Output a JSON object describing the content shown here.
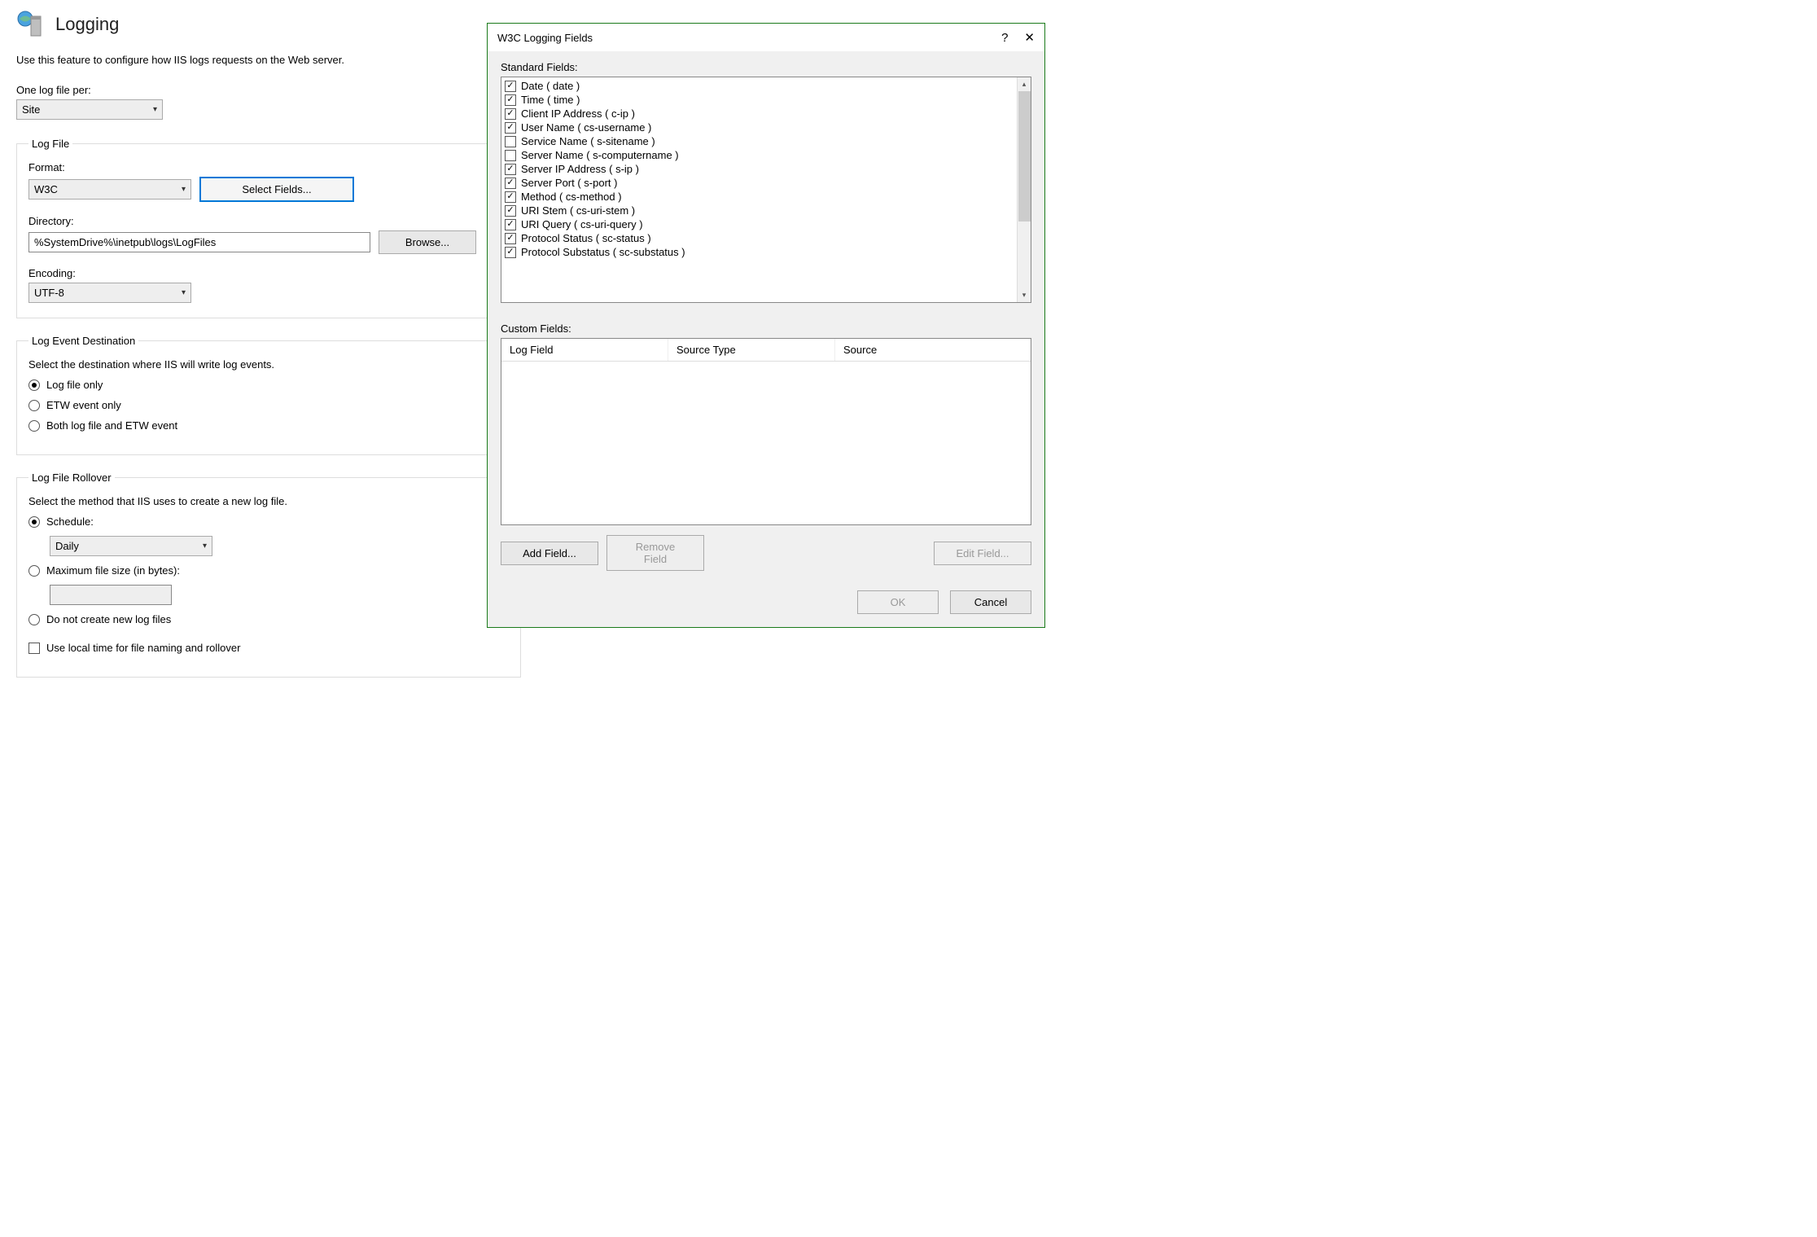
{
  "page": {
    "title": "Logging",
    "description": "Use this feature to configure how IIS logs requests on the Web server.",
    "oneLogFilePerLabel": "One log file per:",
    "oneLogFilePerValue": "Site"
  },
  "logFile": {
    "legend": "Log File",
    "formatLabel": "Format:",
    "formatValue": "W3C",
    "selectFieldsButton": "Select Fields...",
    "directoryLabel": "Directory:",
    "directoryValue": "%SystemDrive%\\inetpub\\logs\\LogFiles",
    "browseButton": "Browse...",
    "encodingLabel": "Encoding:",
    "encodingValue": "UTF-8"
  },
  "logEventDestination": {
    "legend": "Log Event Destination",
    "description": "Select the destination where IIS will write log events.",
    "options": {
      "fileOnly": "Log file only",
      "etwOnly": "ETW event only",
      "both": "Both log file and ETW event"
    }
  },
  "logFileRollover": {
    "legend": "Log File Rollover",
    "description": "Select the method that IIS uses to create a new log file.",
    "scheduleLabel": "Schedule:",
    "scheduleValue": "Daily",
    "maxSizeLabel": "Maximum file size (in bytes):",
    "maxSizeValue": "",
    "noNewLabel": "Do not create new log files",
    "localTimeLabel": "Use local time for file naming and rollover"
  },
  "dialog": {
    "title": "W3C Logging Fields",
    "standardFieldsLabel": "Standard Fields:",
    "customFieldsLabel": "Custom Fields:",
    "customColumns": {
      "logField": "Log Field",
      "sourceType": "Source Type",
      "source": "Source"
    },
    "buttons": {
      "addField": "Add Field...",
      "removeField": "Remove Field",
      "editField": "Edit Field...",
      "ok": "OK",
      "cancel": "Cancel"
    },
    "standardFields": [
      {
        "label": "Date ( date )",
        "checked": true
      },
      {
        "label": "Time ( time )",
        "checked": true
      },
      {
        "label": "Client IP Address ( c-ip )",
        "checked": true
      },
      {
        "label": "User Name ( cs-username )",
        "checked": true
      },
      {
        "label": "Service Name ( s-sitename )",
        "checked": false
      },
      {
        "label": "Server Name ( s-computername )",
        "checked": false
      },
      {
        "label": "Server IP Address ( s-ip )",
        "checked": true
      },
      {
        "label": "Server Port ( s-port )",
        "checked": true
      },
      {
        "label": "Method ( cs-method )",
        "checked": true
      },
      {
        "label": "URI Stem ( cs-uri-stem )",
        "checked": true
      },
      {
        "label": "URI Query ( cs-uri-query )",
        "checked": true
      },
      {
        "label": "Protocol Status ( sc-status )",
        "checked": true
      },
      {
        "label": "Protocol Substatus ( sc-substatus )",
        "checked": true
      }
    ]
  }
}
